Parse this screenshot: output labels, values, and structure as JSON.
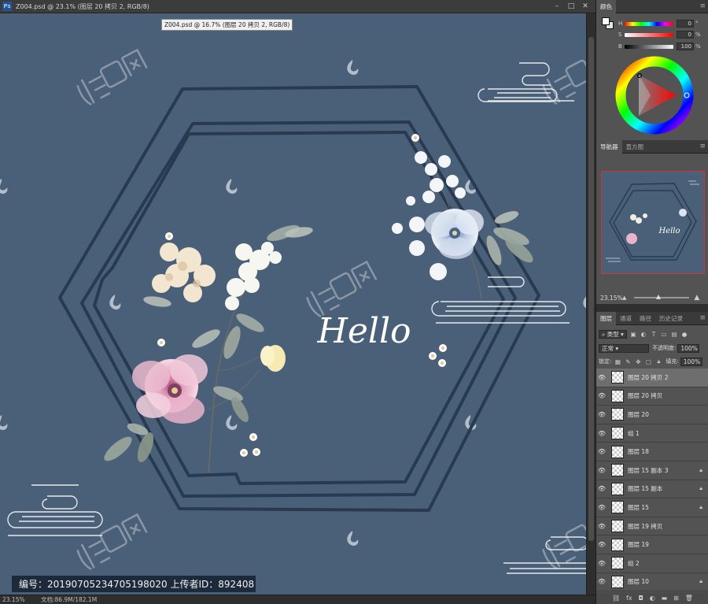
{
  "document": {
    "title": "Z004.psd @ 23.1% (图层 20 拷贝 2, RGB/8)",
    "tooltip": "Z004.psd @ 16.7% (图层 20 拷贝 2, RGB/8)",
    "ps_badge": "Ps",
    "window_controls": [
      "–",
      "□",
      "✕"
    ],
    "status_zoom": "23.15%",
    "status_doc_size": "文档:86.9M/182.1M"
  },
  "artwork": {
    "hello_text": "Hello",
    "watermark_text": "汇图网",
    "watermark_url": "www.huitu.com"
  },
  "watermark_bar": "编号：20190705234705198020 上传者ID：892408",
  "color_panel": {
    "tab": "颜色",
    "rows": [
      {
        "letter": "H",
        "value": "0",
        "unit": "°"
      },
      {
        "letter": "S",
        "value": "0",
        "unit": "%"
      },
      {
        "letter": "B",
        "value": "100",
        "unit": "%"
      }
    ],
    "fg_color": "#ffffff",
    "bg_color": "#e5e5e5"
  },
  "navigator": {
    "tabs": [
      "导航器",
      "直方图"
    ],
    "zoom": "23.15%",
    "hello_text": "Hello"
  },
  "layers": {
    "tabs": [
      "图层",
      "通道",
      "路径",
      "历史记录"
    ],
    "filter_kind": "类型",
    "blend_mode": "正常",
    "opacity_label": "不透明度:",
    "opacity_value": "100%",
    "lock_label": "锁定:",
    "fill_label": "填充:",
    "fill_value": "100%",
    "items": [
      {
        "name": "图层 20 拷贝 2",
        "selected": true,
        "locked": false
      },
      {
        "name": "图层 20 拷贝",
        "selected": false,
        "locked": false
      },
      {
        "name": "图层 20",
        "selected": false,
        "locked": false
      },
      {
        "name": "组 1",
        "selected": false,
        "locked": false
      },
      {
        "name": "图层 18",
        "selected": false,
        "locked": false
      },
      {
        "name": "图层 15 副本 3",
        "selected": false,
        "locked": true
      },
      {
        "name": "图层 15 副本",
        "selected": false,
        "locked": true
      },
      {
        "name": "图层 15",
        "selected": false,
        "locked": true
      },
      {
        "name": "图层 19 拷贝",
        "selected": false,
        "locked": false
      },
      {
        "name": "图层 19",
        "selected": false,
        "locked": false
      },
      {
        "name": "组 2",
        "selected": false,
        "locked": false
      },
      {
        "name": "图层 10",
        "selected": false,
        "locked": true
      }
    ],
    "footer_icons": [
      "link-icon",
      "fx-icon",
      "mask-icon",
      "adjustment-icon",
      "folder-icon",
      "new-layer-icon",
      "trash-icon"
    ]
  }
}
